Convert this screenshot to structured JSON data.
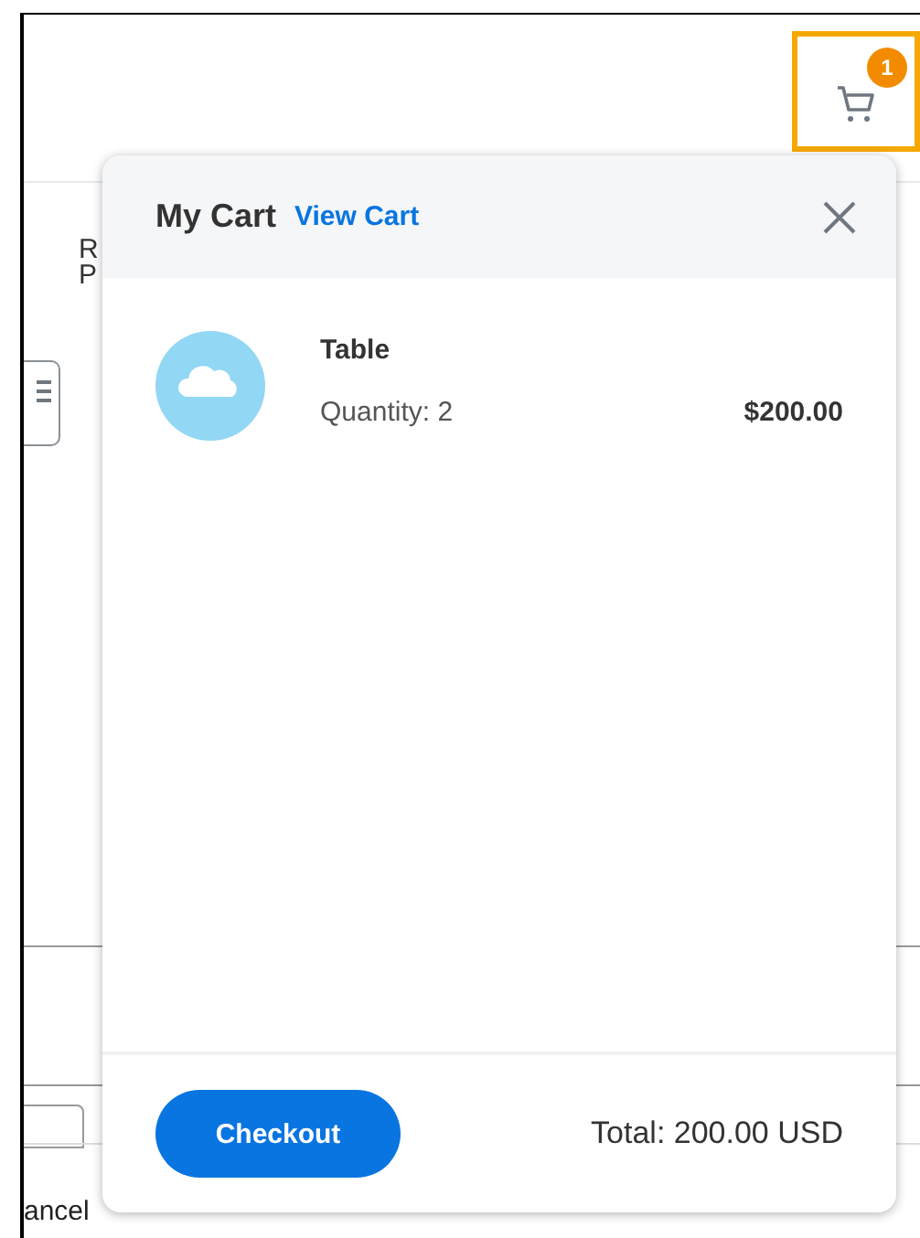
{
  "header": {
    "cart_badge": "1"
  },
  "background": {
    "label_lines": [
      "R",
      "P"
    ],
    "cancel_label": "ancel"
  },
  "cart": {
    "title": "My Cart",
    "view_link": "View Cart",
    "items": [
      {
        "name": "Table",
        "quantity": "Quantity: 2",
        "price": "$200.00"
      }
    ],
    "checkout": "Checkout",
    "total": "Total: 200.00 USD"
  }
}
